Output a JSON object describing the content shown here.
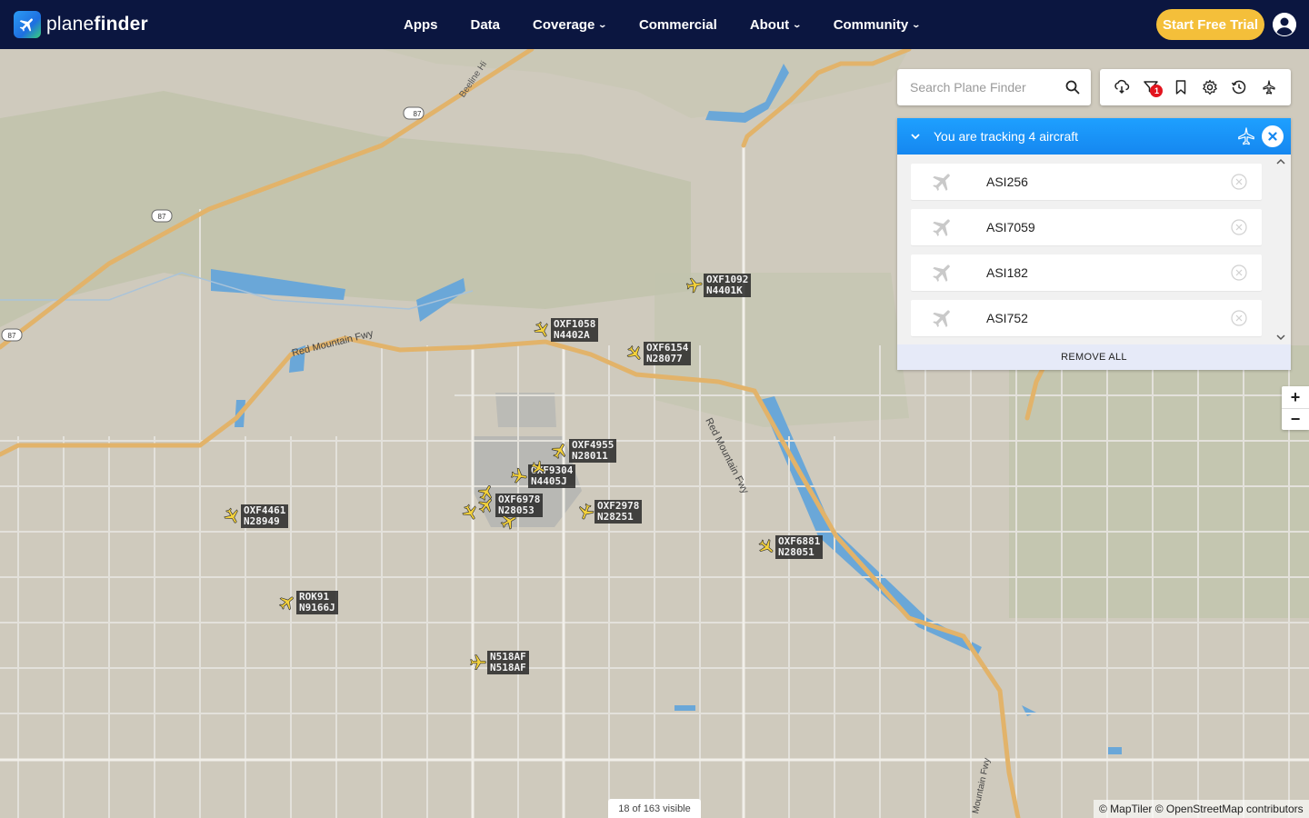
{
  "brand": {
    "name_light": "plane",
    "name_bold": "finder"
  },
  "nav": {
    "items": [
      {
        "label": "Apps"
      },
      {
        "label": "Data"
      },
      {
        "label": "Coverage"
      },
      {
        "label": "Commercial"
      },
      {
        "label": "About"
      },
      {
        "label": "Community"
      }
    ],
    "trial_label": "Start Free Trial"
  },
  "search": {
    "placeholder": "Search Plane Finder"
  },
  "toolbar": {
    "filter_badge": "1"
  },
  "tracking": {
    "title": "You are tracking 4 aircraft",
    "items": [
      {
        "name": "ASI256"
      },
      {
        "name": "ASI7059"
      },
      {
        "name": "ASI182"
      },
      {
        "name": "ASI752"
      }
    ],
    "remove_all_label": "REMOVE ALL"
  },
  "zoom": {
    "in": "+",
    "out": "−"
  },
  "map": {
    "roads": {
      "beeline": "Beeline Hi",
      "red_mountain_w": "Red Mountain Fwy",
      "red_mountain_e": "Red Mountain Fwy",
      "red_mountain_s": "Mountain Fwy",
      "sr87_a": "87",
      "sr87_b": "87",
      "sr87_c": "87"
    },
    "aircraft": [
      {
        "callsign": "OXF1092",
        "reg": "N4401K"
      },
      {
        "callsign": "OXF1058",
        "reg": "N4402A"
      },
      {
        "callsign": "OXF6154",
        "reg": "N28077"
      },
      {
        "callsign": "OXF4955",
        "reg": "N28011"
      },
      {
        "callsign": "OXF9304",
        "reg": "N4405J"
      },
      {
        "callsign": "OXF6978",
        "reg": "N28053"
      },
      {
        "callsign": "OXF2978",
        "reg": "N28251"
      },
      {
        "callsign": "OXF4461",
        "reg": "N28949"
      },
      {
        "callsign": "OXF6881",
        "reg": "N28051"
      },
      {
        "callsign": "ROK91",
        "reg": "N9166J"
      },
      {
        "callsign": "N518AF",
        "reg": "N518AF"
      }
    ],
    "visible_count": "18 of 163 visible",
    "attribution": "© MapTiler © OpenStreetMap contributors"
  },
  "colors": {
    "nav_bg": "#0b1640",
    "trial_btn": "#f4bf3a",
    "panel_header": "#1587f0",
    "map_land": "#cfcabd",
    "water": "#6aa7d8",
    "highway": "#e2b36a",
    "badge": "#e3141e"
  },
  "icons": {
    "logo": "plane-logo-icon",
    "user": "user-icon",
    "search": "search-icon",
    "toolbar": [
      "weather-icon",
      "filter-icon",
      "bookmark-icon",
      "settings-icon",
      "history-icon",
      "airport-icon"
    ]
  }
}
